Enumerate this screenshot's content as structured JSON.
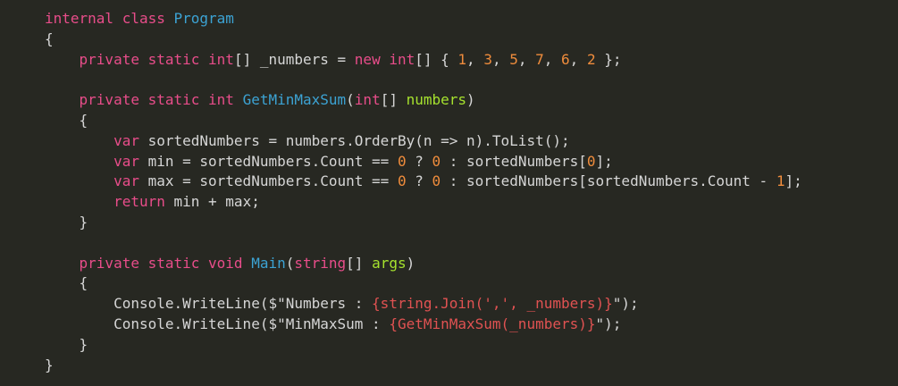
{
  "editor": {
    "theme_colors": {
      "background": "#272822",
      "default": "#d6d6d6",
      "keyword": "#e84d8a",
      "type_name": "#3ca3d4",
      "number": "#ef8c3c",
      "parameter": "#a6e22e",
      "string": "#d6d6d6",
      "interpolation": "#e05252"
    },
    "lines": [
      [
        {
          "t": "internal class ",
          "c": "keyword"
        },
        {
          "t": "Program",
          "c": "type_name"
        }
      ],
      [
        {
          "t": "{",
          "c": "default"
        }
      ],
      [
        {
          "t": "    private static ",
          "c": "keyword"
        },
        {
          "t": "int",
          "c": "keyword"
        },
        {
          "t": "[] _numbers = ",
          "c": "default"
        },
        {
          "t": "new ",
          "c": "keyword"
        },
        {
          "t": "int",
          "c": "keyword"
        },
        {
          "t": "[] { ",
          "c": "default"
        },
        {
          "t": "1",
          "c": "number"
        },
        {
          "t": ", ",
          "c": "default"
        },
        {
          "t": "3",
          "c": "number"
        },
        {
          "t": ", ",
          "c": "default"
        },
        {
          "t": "5",
          "c": "number"
        },
        {
          "t": ", ",
          "c": "default"
        },
        {
          "t": "7",
          "c": "number"
        },
        {
          "t": ", ",
          "c": "default"
        },
        {
          "t": "6",
          "c": "number"
        },
        {
          "t": ", ",
          "c": "default"
        },
        {
          "t": "2",
          "c": "number"
        },
        {
          "t": " };",
          "c": "default"
        }
      ],
      [],
      [
        {
          "t": "    private static ",
          "c": "keyword"
        },
        {
          "t": "int ",
          "c": "keyword"
        },
        {
          "t": "GetMinMaxSum",
          "c": "type_name"
        },
        {
          "t": "(",
          "c": "default"
        },
        {
          "t": "int",
          "c": "keyword"
        },
        {
          "t": "[] ",
          "c": "default"
        },
        {
          "t": "numbers",
          "c": "parameter"
        },
        {
          "t": ")",
          "c": "default"
        }
      ],
      [
        {
          "t": "    {",
          "c": "default"
        }
      ],
      [
        {
          "t": "        var ",
          "c": "keyword"
        },
        {
          "t": "sortedNumbers = numbers.OrderBy(n => n).ToList();",
          "c": "default"
        }
      ],
      [
        {
          "t": "        var ",
          "c": "keyword"
        },
        {
          "t": "min = sortedNumbers.Count == ",
          "c": "default"
        },
        {
          "t": "0",
          "c": "number"
        },
        {
          "t": " ? ",
          "c": "default"
        },
        {
          "t": "0",
          "c": "number"
        },
        {
          "t": " : sortedNumbers[",
          "c": "default"
        },
        {
          "t": "0",
          "c": "number"
        },
        {
          "t": "];",
          "c": "default"
        }
      ],
      [
        {
          "t": "        var ",
          "c": "keyword"
        },
        {
          "t": "max = sortedNumbers.Count == ",
          "c": "default"
        },
        {
          "t": "0",
          "c": "number"
        },
        {
          "t": " ? ",
          "c": "default"
        },
        {
          "t": "0",
          "c": "number"
        },
        {
          "t": " : sortedNumbers[sortedNumbers.Count - ",
          "c": "default"
        },
        {
          "t": "1",
          "c": "number"
        },
        {
          "t": "];",
          "c": "default"
        }
      ],
      [
        {
          "t": "        return ",
          "c": "keyword"
        },
        {
          "t": "min + max;",
          "c": "default"
        }
      ],
      [
        {
          "t": "    }",
          "c": "default"
        }
      ],
      [],
      [
        {
          "t": "    private static ",
          "c": "keyword"
        },
        {
          "t": "void ",
          "c": "keyword"
        },
        {
          "t": "Main",
          "c": "type_name"
        },
        {
          "t": "(",
          "c": "default"
        },
        {
          "t": "string",
          "c": "keyword"
        },
        {
          "t": "[] ",
          "c": "default"
        },
        {
          "t": "args",
          "c": "parameter"
        },
        {
          "t": ")",
          "c": "default"
        }
      ],
      [
        {
          "t": "    {",
          "c": "default"
        }
      ],
      [
        {
          "t": "        Console.WriteLine($\"Numbers : ",
          "c": "string"
        },
        {
          "t": "{string.Join(',', _numbers)}",
          "c": "interpolation"
        },
        {
          "t": "\");",
          "c": "default"
        }
      ],
      [
        {
          "t": "        Console.WriteLine($\"MinMaxSum : ",
          "c": "string"
        },
        {
          "t": "{GetMinMaxSum(_numbers)}",
          "c": "interpolation"
        },
        {
          "t": "\");",
          "c": "default"
        }
      ],
      [
        {
          "t": "    }",
          "c": "default"
        }
      ],
      [
        {
          "t": "}",
          "c": "default"
        }
      ]
    ]
  }
}
